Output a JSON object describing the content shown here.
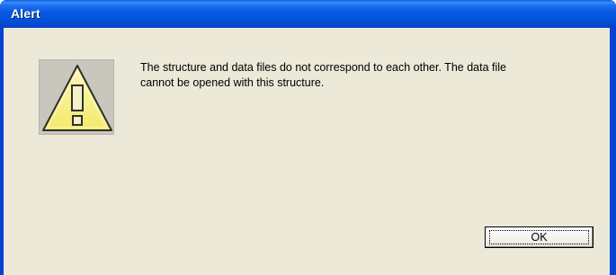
{
  "window": {
    "title": "Alert"
  },
  "dialog": {
    "icon": "warning-icon",
    "message_lines": [
      "The structure and data files do not correspond to each other. The data file",
      "cannot be opened with this structure."
    ],
    "ok_label": "OK"
  },
  "colors": {
    "titlebar": "#0658e2",
    "frame": "#0842d4",
    "client_background": "#ece9d8",
    "warning_fill": "#f7f08a",
    "warning_outline": "#2f2f2f"
  }
}
